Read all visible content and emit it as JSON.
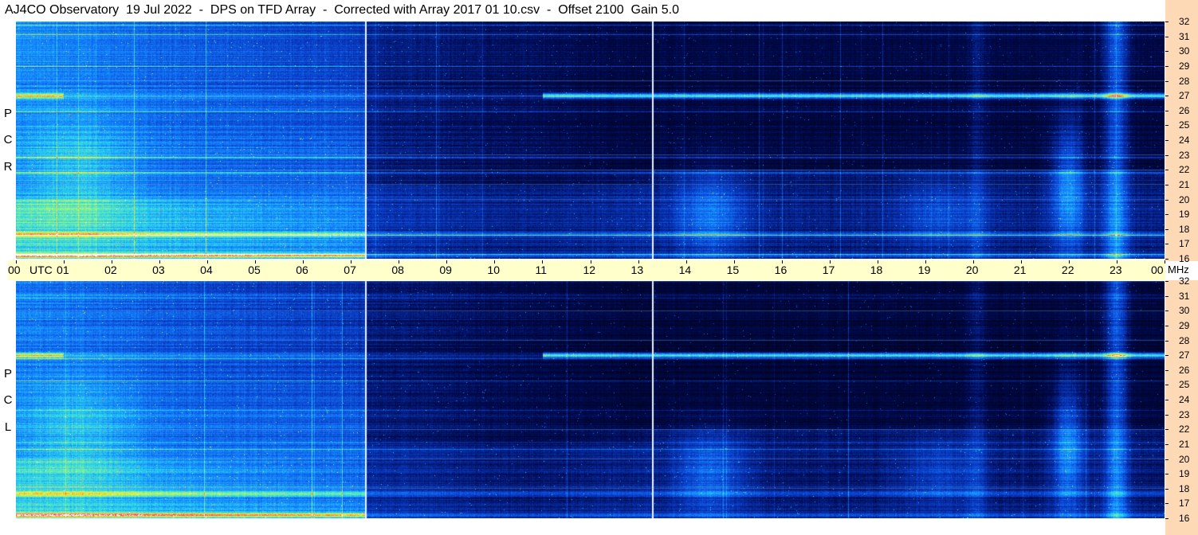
{
  "title": "AJ4CO Observatory  19 Jul 2022  -  DPS on TFD Array  -  Corrected with Array 2017 01 10.csv  -  Offset 2100  Gain 5.0",
  "panels": [
    {
      "id": "rcp",
      "polarization_letters": [
        "R",
        "C",
        "P"
      ]
    },
    {
      "id": "lcp",
      "polarization_letters": [
        "L",
        "C",
        "P"
      ]
    }
  ],
  "time_axis": {
    "labels": [
      "00",
      "01",
      "02",
      "03",
      "04",
      "05",
      "06",
      "07",
      "08",
      "09",
      "10",
      "11",
      "12",
      "13",
      "14",
      "15",
      "16",
      "17",
      "18",
      "19",
      "20",
      "21",
      "22",
      "23",
      "00"
    ],
    "utc_label": "UTC",
    "unit_label": "MHz"
  },
  "frequency_axis": {
    "labels": [
      "32",
      "31",
      "30",
      "29",
      "28",
      "27",
      "26",
      "25",
      "24",
      "23",
      "22",
      "21",
      "20",
      "19",
      "18",
      "17",
      "16"
    ]
  },
  "colors": {
    "background_band": "#000010",
    "scale_bg": "#fdd9b5",
    "time_axis_bg": "#ffffcc"
  },
  "chart_data": {
    "type": "heatmap",
    "title": "AJ4CO Observatory  19 Jul 2022  -  DPS on TFD Array  -  Corrected with Array 2017 01 10.csv  -  Offset 2100  Gain 5.0",
    "xlabel": "UTC",
    "ylabel": "MHz",
    "x_range_hours": [
      0,
      24
    ],
    "y_range_mhz": [
      16,
      32
    ],
    "series": [
      {
        "name": "RCP"
      },
      {
        "name": "LCP"
      }
    ],
    "vertical_marker_times_utc_hours": [
      7.3,
      13.3
    ],
    "strong_band_mhz": 27.0
  }
}
